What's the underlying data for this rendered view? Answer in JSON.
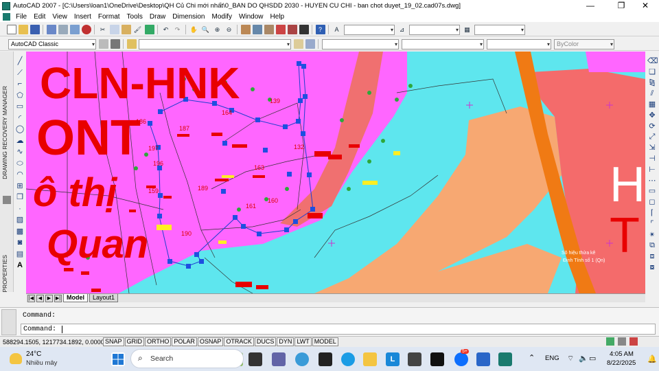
{
  "window": {
    "title": "AutoCAD 2007 - [C:\\Users\\loan1\\OneDrive\\Desktop\\QH Củ Chi mới nhất\\0_BAN DO QHSDD 2030 - HUYEN CU CHI - ban chot duyet_19_02.cad07s.dwg]",
    "controls": {
      "minimize": "—",
      "restore": "❐",
      "close": "✕"
    }
  },
  "menu": {
    "items": [
      "File",
      "Edit",
      "View",
      "Insert",
      "Format",
      "Tools",
      "Draw",
      "Dimension",
      "Modify",
      "Window",
      "Help"
    ]
  },
  "toolbar2": {
    "workspace": "AutoCAD Classic",
    "layer_combo": "",
    "color_combo": "",
    "linetype_combo": "",
    "lineweight_combo": "",
    "plotstyle_combo": "ByColor"
  },
  "side_panels": {
    "drawing_recovery": "DRAWING RECOVERY MANAGER",
    "properties": "PROPERTIES"
  },
  "drawing": {
    "big_labels": [
      "CLN-HNK",
      "ONT",
      "ô thị",
      "Quan",
      "H",
      "T"
    ],
    "parcel_numbers": [
      "187",
      "164",
      "197",
      "196",
      "189",
      "161",
      "160",
      "163",
      "190",
      "159",
      "186",
      "139",
      "132"
    ],
    "note_lines": [
      "Sô hiệu thửa kê",
      "Định Tính số 1 (Qn)"
    ]
  },
  "layout_tabs": {
    "nav": [
      "|◀",
      "◀",
      "▶",
      "▶|"
    ],
    "tabs": [
      "Model",
      "Layout1"
    ],
    "active": "Model"
  },
  "command": {
    "line1": "Command:",
    "line2": "Command:"
  },
  "status": {
    "coordinates": "588294.1505, 1217734.1892, 0.0000",
    "toggles": [
      "SNAP",
      "GRID",
      "ORTHO",
      "POLAR",
      "OSNAP",
      "OTRACK",
      "DUCS",
      "DYN",
      "LWT",
      "MODEL"
    ]
  },
  "taskbar": {
    "weather_temp": "24°C",
    "weather_desc": "Nhiều mây",
    "search_placeholder": "Search",
    "language": "ENG",
    "time": "4:05 AM",
    "date": "8/22/2025",
    "zalo_badge": "5+"
  },
  "colors": {
    "cyan": "#5ee6ee",
    "magenta": "#ff66ff",
    "orange": "#f7a872",
    "salmon": "#f46b6b",
    "red_text": "#e80000",
    "dark_orange": "#f07a14"
  }
}
